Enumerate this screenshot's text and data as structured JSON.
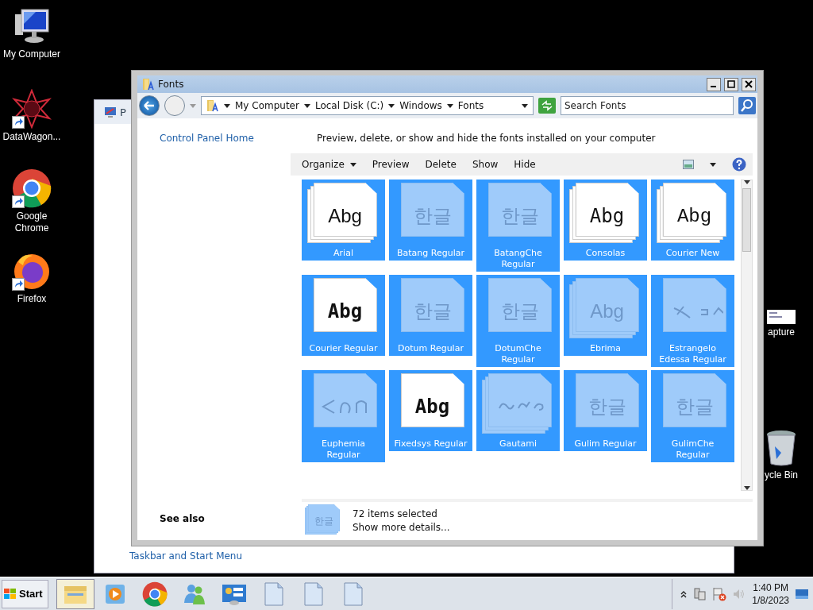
{
  "desktop_icons": [
    {
      "label": "My Computer",
      "kind": "computer",
      "shortcut": false
    },
    {
      "label": "DataWagon...",
      "kind": "star",
      "shortcut": true
    },
    {
      "label": "Google Chrome",
      "kind": "chrome",
      "shortcut": true
    },
    {
      "label": "Firefox",
      "kind": "firefox",
      "shortcut": true
    }
  ],
  "right_icons": [
    {
      "label": "apture",
      "kind": "screenshot"
    },
    {
      "label": "ycle Bin",
      "kind": "bin"
    }
  ],
  "back_window": {
    "title": "P",
    "link": "Taskbar and Start Menu"
  },
  "window": {
    "title": "Fonts",
    "address": [
      "My Computer",
      "Local Disk (C:)",
      "Windows",
      "Fonts"
    ],
    "search": {
      "placeholder": "Search Fonts"
    },
    "sidebar": {
      "link": "Control Panel Home",
      "see_also": "See also"
    },
    "heading": "Preview, delete, or show and hide the fonts installed on your computer",
    "toolbar": [
      {
        "label": "Organize",
        "dropdown": true
      },
      {
        "label": "Preview",
        "dropdown": false
      },
      {
        "label": "Delete",
        "dropdown": false
      },
      {
        "label": "Show",
        "dropdown": false
      },
      {
        "label": "Hide",
        "dropdown": false
      }
    ],
    "fonts": [
      {
        "name": "Arial",
        "kind": "sans",
        "preview": "Abg",
        "hidden": false,
        "family": true,
        "selected": true
      },
      {
        "name": "Batang Regular",
        "kind": "hangul",
        "preview": "한글",
        "hidden": true,
        "family": false,
        "selected": true
      },
      {
        "name": "BatangChe Regular",
        "kind": "hangul",
        "preview": "한글",
        "hidden": true,
        "family": false,
        "selected": true
      },
      {
        "name": "Consolas",
        "kind": "mono",
        "preview": "Abg",
        "hidden": false,
        "family": true,
        "selected": true
      },
      {
        "name": "Courier New",
        "kind": "courier",
        "preview": "Abg",
        "hidden": false,
        "family": true,
        "selected": true
      },
      {
        "name": "Courier Regular",
        "kind": "bitmap",
        "preview": "Abg",
        "hidden": false,
        "family": false,
        "selected": true
      },
      {
        "name": "Dotum Regular",
        "kind": "hangul",
        "preview": "한글",
        "hidden": true,
        "family": false,
        "selected": true
      },
      {
        "name": "DotumChe Regular",
        "kind": "hangul",
        "preview": "한글",
        "hidden": true,
        "family": false,
        "selected": true
      },
      {
        "name": "Ebrima",
        "kind": "sans",
        "preview": "Abg",
        "hidden": true,
        "family": true,
        "selected": true
      },
      {
        "name": "Estrangelo Edessa Regular",
        "kind": "script",
        "hidden": true,
        "family": false,
        "selected": true
      },
      {
        "name": "Euphemia Regular",
        "kind": "script",
        "hidden": true,
        "family": false,
        "selected": true
      },
      {
        "name": "Fixedsys Regular",
        "kind": "bitmap",
        "preview": "Abg",
        "hidden": false,
        "family": false,
        "selected": true
      },
      {
        "name": "Gautami",
        "kind": "script",
        "hidden": true,
        "family": true,
        "selected": true
      },
      {
        "name": "Gulim Regular",
        "kind": "hangul",
        "preview": "한글",
        "hidden": true,
        "family": false,
        "selected": true
      },
      {
        "name": "GulimChe Regular",
        "kind": "hangul",
        "preview": "한글",
        "hidden": true,
        "family": false,
        "selected": true
      }
    ],
    "details": {
      "preview": "한글",
      "count": "72 items selected",
      "more": "Show more details..."
    }
  },
  "taskbar": {
    "start": "Start",
    "apps": [
      {
        "kind": "explorer",
        "active": true
      },
      {
        "kind": "media",
        "active": false
      },
      {
        "kind": "chrome",
        "active": false
      },
      {
        "kind": "messenger",
        "active": false
      },
      {
        "kind": "control",
        "active": false
      },
      {
        "kind": "document",
        "active": false
      },
      {
        "kind": "document",
        "active": false
      },
      {
        "kind": "document",
        "active": false
      }
    ],
    "time": "1:40 PM",
    "date": "1/8/2023"
  }
}
